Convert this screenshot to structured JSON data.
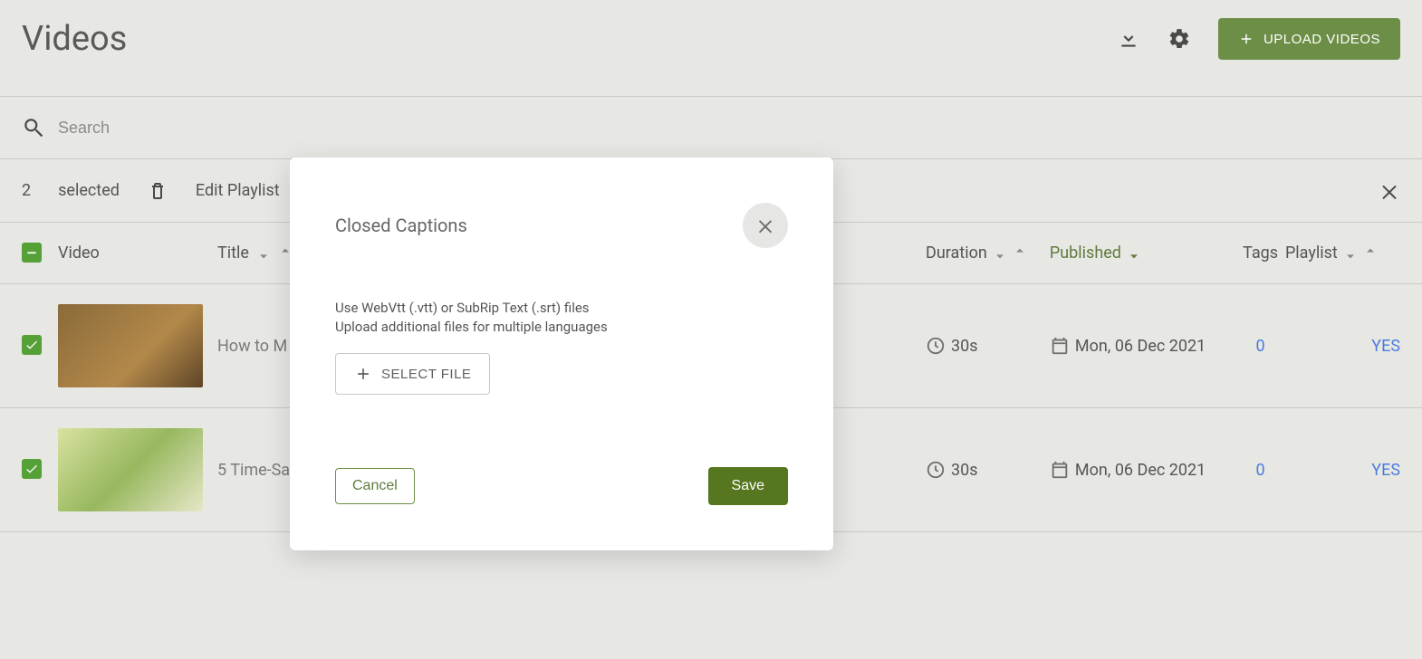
{
  "header": {
    "title": "Videos",
    "upload_label": "UPLOAD VIDEOS"
  },
  "search": {
    "placeholder": "Search"
  },
  "selection": {
    "count": "2",
    "label": "selected",
    "edit_playlist": "Edit Playlist"
  },
  "columns": {
    "video": "Video",
    "title": "Title",
    "duration": "Duration",
    "published": "Published",
    "tags": "Tags",
    "playlist": "Playlist"
  },
  "rows": [
    {
      "title": "How to M",
      "duration": "30s",
      "published": "Mon, 06 Dec 2021",
      "tags": "0",
      "playlist": "YES"
    },
    {
      "title": "5 Time-Sa",
      "duration": "30s",
      "published": "Mon, 06 Dec 2021",
      "tags": "0",
      "playlist": "YES"
    }
  ],
  "modal": {
    "title": "Closed Captions",
    "line1": "Use WebVtt (.vtt) or SubRip Text (.srt) files",
    "line2": "Upload additional files for multiple languages",
    "select_file": "SELECT FILE",
    "cancel": "Cancel",
    "save": "Save"
  }
}
